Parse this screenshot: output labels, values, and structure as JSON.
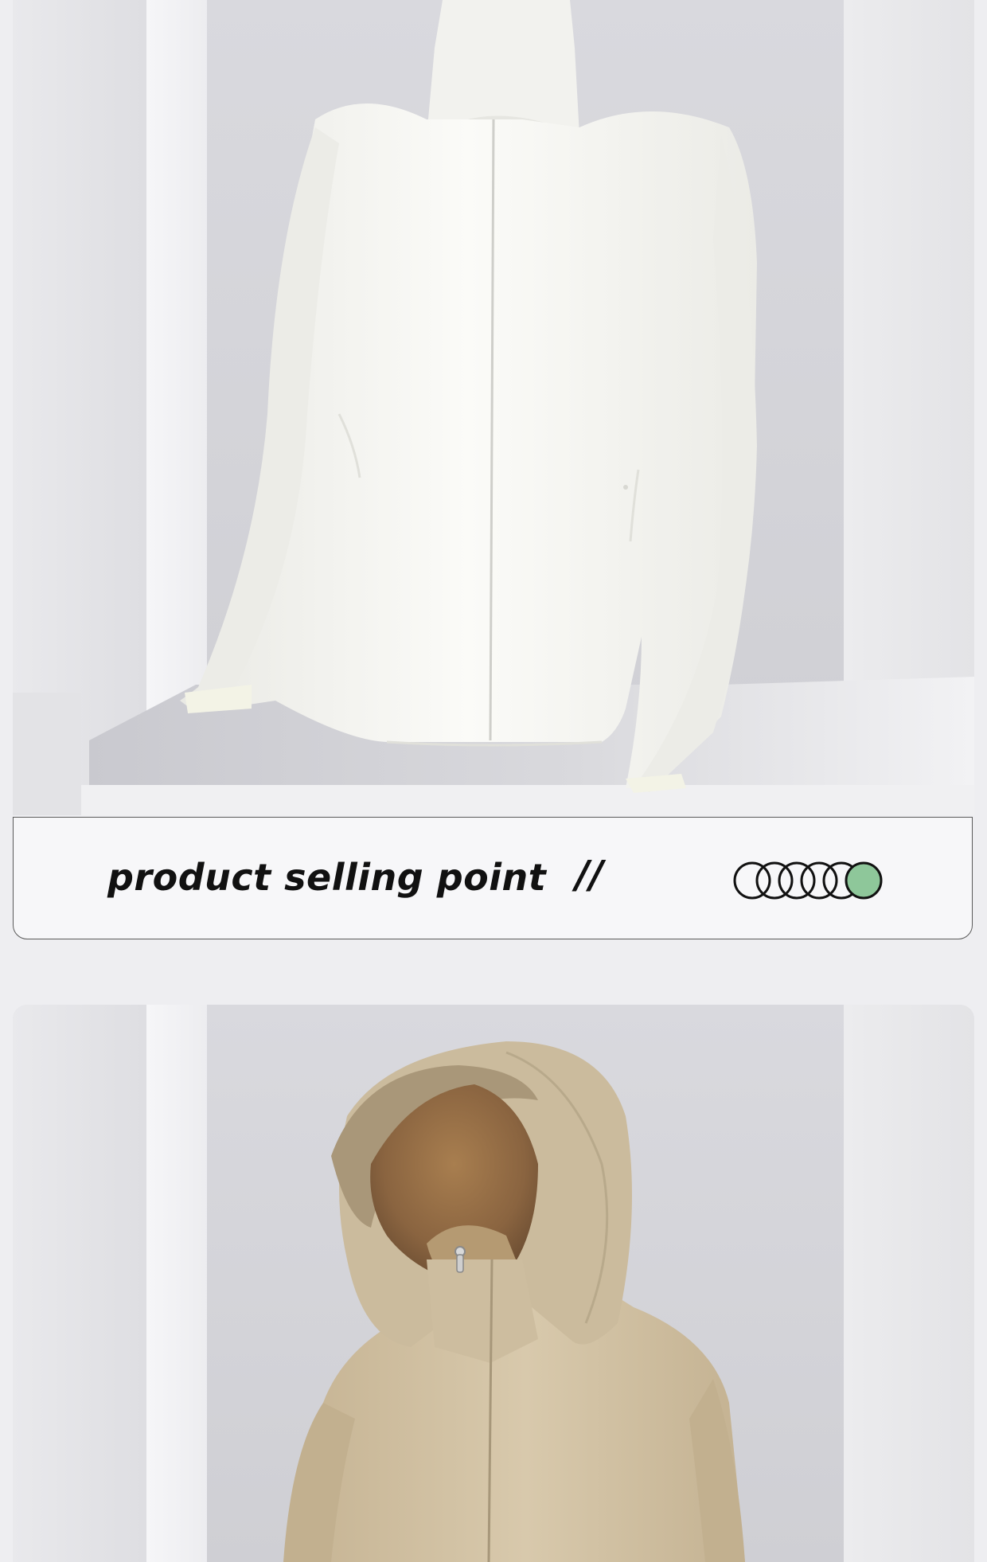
{
  "banner": {
    "title": "product selling point",
    "separator": "//",
    "indicator": {
      "count": 6,
      "active_index": 5,
      "active_color": "#8ec79a",
      "outline_color": "#111111"
    }
  },
  "images": {
    "top": {
      "subject": "white hooded sun-protection jacket on display pedestal"
    },
    "bottom": {
      "subject": "khaki hooded sun-protection jacket with brim hood"
    }
  },
  "colors": {
    "background": "#eeeef1",
    "jacket_white": "#f4f4f0",
    "jacket_khaki": "#d2c3a6",
    "accent": "#8ec79a"
  }
}
